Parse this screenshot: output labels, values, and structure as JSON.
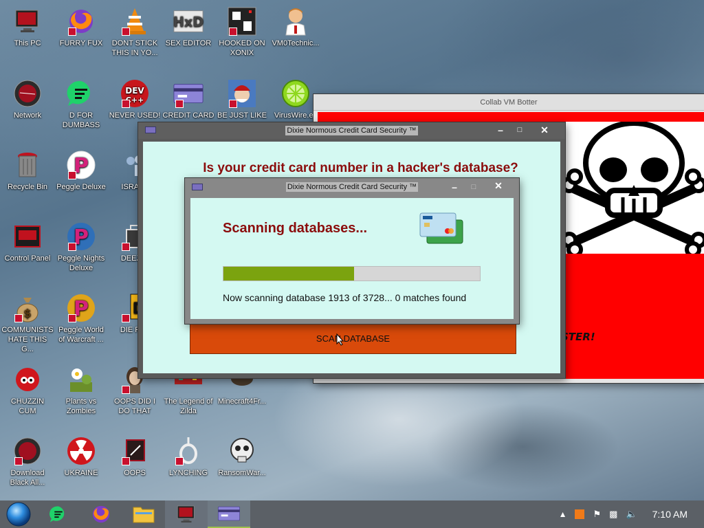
{
  "desktop": {
    "icons": [
      {
        "label": "This PC",
        "icon": "monitor-icon"
      },
      {
        "label": "FURRY FUX",
        "icon": "firefox-icon"
      },
      {
        "label": "DONT STICK THIS IN YO...",
        "icon": "vlc-cone-icon"
      },
      {
        "label": "SEX EDITOR",
        "icon": "hxd-icon"
      },
      {
        "label": "HOOKED ON XONIX",
        "icon": "xonix-icon"
      },
      {
        "label": "VM0Technic...",
        "icon": "doctor-icon"
      },
      {
        "label": "Network",
        "icon": "network-icon"
      },
      {
        "label": "D FOR DUMBASS",
        "icon": "chat-icon"
      },
      {
        "label": "NEVER USED!",
        "icon": "devcpp-icon"
      },
      {
        "label": "CREDIT CARD",
        "icon": "credit-card-icon"
      },
      {
        "label": "BE JUST LIKE",
        "icon": "elf-icon"
      },
      {
        "label": "VirusWire.ex",
        "icon": "lime-icon"
      },
      {
        "label": "Recycle Bin",
        "icon": "recycle-bin-icon"
      },
      {
        "label": "Peggle Deluxe",
        "icon": "peggle-icon"
      },
      {
        "label": "ISRAEL",
        "icon": "people-icon"
      },
      {
        "label": "Control Panel",
        "icon": "control-panel-icon"
      },
      {
        "label": "Peggle Nights Deluxe",
        "icon": "peggle-icon"
      },
      {
        "label": "DEEZ N",
        "icon": "copy-icon"
      },
      {
        "label": "COMMUNISTS HATE THIS G...",
        "icon": "money-bag-icon"
      },
      {
        "label": "Peggle World of Warcraft ...",
        "icon": "peggle-icon"
      },
      {
        "label": "DIE PLE",
        "icon": "die-icon"
      },
      {
        "label": "CHUZZIN CUM",
        "icon": "chuzzle-icon"
      },
      {
        "label": "Plants vs Zombies",
        "icon": "flower-icon"
      },
      {
        "label": "OOPS DID I DO THAT",
        "icon": "portrait-icon"
      },
      {
        "label": "The Legend of Zilda",
        "icon": "zelda-icon"
      },
      {
        "label": "Minecraft4Fr...",
        "icon": "minecraft-icon"
      },
      {
        "label": "Download Black All...",
        "icon": "network-icon"
      },
      {
        "label": "UKRAINE",
        "icon": "radiation-icon"
      },
      {
        "label": "OOPS",
        "icon": "oops-icon"
      },
      {
        "label": "LYNCHING",
        "icon": "noose-icon"
      },
      {
        "label": "RansomWar...",
        "icon": "skull-icon"
      }
    ]
  },
  "windows": {
    "bg_botter": {
      "title": "Collab VM Botter",
      "banner_text": "STER!"
    },
    "main": {
      "title": "Dixie Normous Credit Card Security ™",
      "heading": "Is your credit card number in a hacker's database?",
      "scan_button": "SCAN DATABASE"
    },
    "dialog": {
      "title": "Dixie Normous Credit Card Security ™",
      "heading": "Scanning databases...",
      "progress_fraction": 0.51,
      "status": "Now scanning database 1913 of 3728... 0 matches found"
    }
  },
  "taskbar": {
    "apps": [
      "start-orb-icon",
      "chat-icon",
      "firefox-icon",
      "file-explorer-icon",
      "monitor-icon",
      "credit-card-icon"
    ],
    "clock": "7:10 AM"
  },
  "colors": {
    "dialog_bg": "#d4f9f2",
    "heading_red": "#8b0d0d",
    "progress_green": "#7ba30f",
    "scan_button": "#d94a0a",
    "banner_red": "#ff0000"
  }
}
